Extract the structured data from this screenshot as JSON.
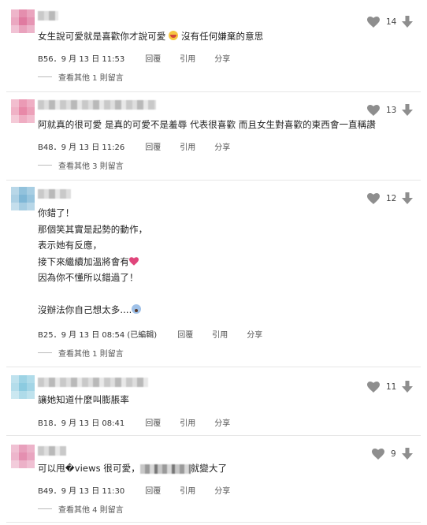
{
  "comments": [
    {
      "avatar_color": "#e07aa0",
      "text": "女生說可愛就是喜歡你才說可愛",
      "text_tail": "沒有任何嫌棄的意思",
      "likes": "14",
      "floor": "B56",
      "time": "9 月 13 日 11:53",
      "reply": "回覆",
      "quote": "引用",
      "share": "分享",
      "more": "查看其他 1 則留言"
    },
    {
      "avatar_color": "#e889a8",
      "text": "阿就真的很可愛 是真的可愛不是羞辱 代表很喜歡 而且女生對喜歡的東西會一直稱讚",
      "likes": "13",
      "floor": "B48",
      "time": "9 月 13 日 11:26",
      "reply": "回覆",
      "quote": "引用",
      "share": "分享",
      "more": "查看其他 3 則留言"
    },
    {
      "avatar_color": "#7fb7d6",
      "lines": [
        "你錯了！",
        "那個笑其實是起勢的動作，",
        "表示她有反應，",
        "接下來繼續加溫將會有",
        "因為你不懂所以錯過了！",
        "",
        "沒辦法你自己想太多...."
      ],
      "likes": "12",
      "floor": "B25",
      "time": "9 月 13 日 08:54 (已編輯)",
      "reply": "回覆",
      "quote": "引用",
      "share": "分享",
      "more": "查看其他 1 則留言"
    },
    {
      "avatar_color": "#8ccbe0",
      "text": "讓她知道什麼叫膨脹率",
      "likes": "11",
      "floor": "B18",
      "time": "9 月 13 日 08:41",
      "reply": "回覆",
      "quote": "引用",
      "share": "分享"
    },
    {
      "avatar_color": "#e48fb0",
      "text_head": "可以甩�views 很可愛，",
      "text_tail": "就變大了",
      "likes": "9",
      "floor": "B49",
      "time": "9 月 13 日 11:30",
      "reply": "回覆",
      "quote": "引用",
      "share": "分享",
      "more": "查看其他 4 則留言"
    }
  ]
}
